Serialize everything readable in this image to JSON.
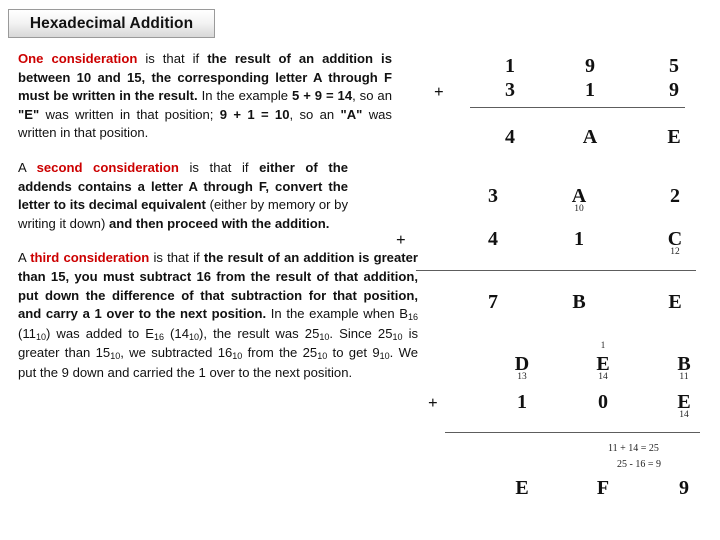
{
  "title": {
    "text": "Hexadecimal Addition"
  },
  "colors": {
    "highlight": "#cc0000",
    "text": "#111111",
    "rule": "#5d5d5d"
  },
  "paragraphs": {
    "p1": {
      "highlight": "One consideration",
      "seg_a": " is that if ",
      "seg_b": "the result of an addition is between 10 and 15, the corresponding letter A through F must be written in the result.",
      "seg_c": " In the example ",
      "seg_d": "5 + 9 = 14",
      "seg_e": ", so an ",
      "seg_f": "\"E\"",
      "seg_g": " was written in that position; ",
      "seg_h": "9 + 1 = 10",
      "seg_i": ", so an ",
      "seg_j": "\"A\"",
      "seg_k": " was written in that position."
    },
    "p2": {
      "lead": "A ",
      "highlight": "second consideration",
      "seg_a": " is that if ",
      "seg_b": "either of the addends contains a letter A through F, convert the letter to its decimal equivalent",
      "seg_c": " (either by memory or by writing it down)",
      "seg_d": " and then proceed with the addition."
    },
    "p3": {
      "lead": "A ",
      "highlight": "third consideration",
      "seg_a": " is that if ",
      "seg_b": "the result of an addition is greater than 15, you must subtract 16 from the result of that addition, put down the difference of that subtraction for that position, and carry a 1 over to the next position.",
      "seg_c": " In the example when B",
      "sub1": "16",
      "seg_d": " (11",
      "sub2": "10",
      "seg_e": ") was added to E",
      "sub3": "16",
      "seg_f": " (14",
      "sub4": "10",
      "seg_g": "), the result was 25",
      "sub5": "10",
      "seg_h": ". Since 25",
      "sub6": "10",
      "seg_i": " is greater than 15",
      "sub7": "10",
      "seg_j": ", we subtracted 16",
      "sub8": "10",
      "seg_k": " from the 25",
      "sub9": "10",
      "seg_l": " to get 9",
      "sub10": "10",
      "seg_m": ". We put the 9 down and carried the 1 over to the next position."
    }
  },
  "examples": [
    {
      "id": "example-1",
      "operator": "+",
      "addend1": [
        "1",
        "9",
        "5"
      ],
      "addend2": [
        "3",
        "1",
        "9"
      ],
      "sum": [
        "4",
        "A",
        "E"
      ]
    },
    {
      "id": "example-2",
      "operator": "+",
      "addend1": [
        "3",
        "A",
        "2"
      ],
      "addend1_subs": [
        "",
        "10",
        ""
      ],
      "addend2": [
        "4",
        "1",
        "C"
      ],
      "addend2_subs": [
        "",
        "",
        "12"
      ],
      "sum": [
        "7",
        "B",
        "E"
      ]
    },
    {
      "id": "example-3",
      "operator": "+",
      "carry": "1",
      "addend1": [
        "D",
        "E",
        "B"
      ],
      "addend1_subs": [
        "13",
        "14",
        "11"
      ],
      "addend2": [
        "1",
        "0",
        "E"
      ],
      "addend2_subs": [
        "",
        "",
        "14"
      ],
      "sum": [
        "E",
        "F",
        "9"
      ],
      "note_line1": "11 + 14 = 25",
      "note_line2": "25 - 16 = 9"
    }
  ]
}
